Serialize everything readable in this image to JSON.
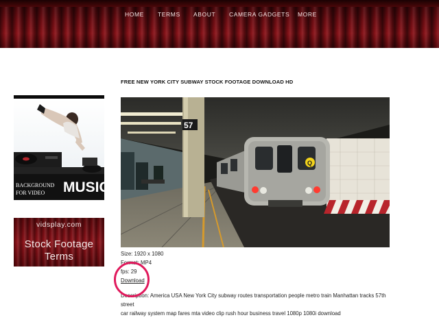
{
  "nav": {
    "items": [
      "HOME",
      "TERMS",
      "ABOUT",
      "CAMERA GADGETS",
      "MORE"
    ]
  },
  "sidebar": {
    "banner_music": {
      "line1": "BACKGROUND",
      "line2": "FOR VIDEO",
      "word": "MUSIC"
    },
    "banner_vids": {
      "site": "vidsplay.com",
      "line1": "Stock Footage",
      "line2": "Terms"
    }
  },
  "main": {
    "title": "FREE NEW YORK CITY SUBWAY STOCK FOOTAGE DOWNLOAD HD",
    "image_sign": "57",
    "train_sign": "Q",
    "size": "Size: 1920 x 1080",
    "format": "Format: MP4",
    "fps": "fps: 29",
    "download": "Download",
    "description_line1": "Description: America USA New York City subway routes transportation people metro train Manhattan tracks 57th street",
    "description_line2": "car railway system map fares mta video clip rush hour business travel 1080p 1080i download"
  },
  "colors": {
    "curtain": "#7a0e14",
    "annotation": "#e0195c"
  }
}
